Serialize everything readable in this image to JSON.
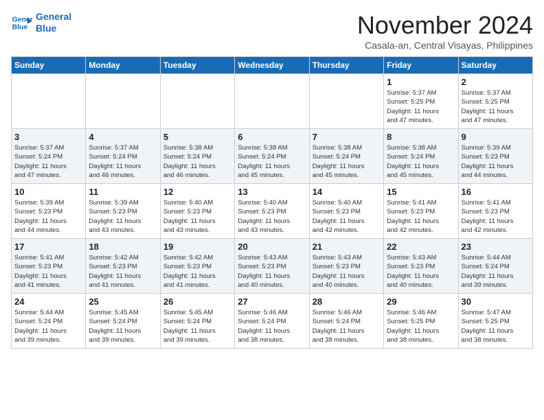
{
  "logo": {
    "line1": "General",
    "line2": "Blue"
  },
  "title": "November 2024",
  "location": "Casala-an, Central Visayas, Philippines",
  "columns": [
    "Sunday",
    "Monday",
    "Tuesday",
    "Wednesday",
    "Thursday",
    "Friday",
    "Saturday"
  ],
  "weeks": [
    [
      {
        "day": "",
        "info": ""
      },
      {
        "day": "",
        "info": ""
      },
      {
        "day": "",
        "info": ""
      },
      {
        "day": "",
        "info": ""
      },
      {
        "day": "",
        "info": ""
      },
      {
        "day": "1",
        "info": "Sunrise: 5:37 AM\nSunset: 5:25 PM\nDaylight: 11 hours\nand 47 minutes."
      },
      {
        "day": "2",
        "info": "Sunrise: 5:37 AM\nSunset: 5:25 PM\nDaylight: 11 hours\nand 47 minutes."
      }
    ],
    [
      {
        "day": "3",
        "info": "Sunrise: 5:37 AM\nSunset: 5:24 PM\nDaylight: 11 hours\nand 47 minutes."
      },
      {
        "day": "4",
        "info": "Sunrise: 5:37 AM\nSunset: 5:24 PM\nDaylight: 11 hours\nand 46 minutes."
      },
      {
        "day": "5",
        "info": "Sunrise: 5:38 AM\nSunset: 5:24 PM\nDaylight: 11 hours\nand 46 minutes."
      },
      {
        "day": "6",
        "info": "Sunrise: 5:38 AM\nSunset: 5:24 PM\nDaylight: 11 hours\nand 45 minutes."
      },
      {
        "day": "7",
        "info": "Sunrise: 5:38 AM\nSunset: 5:24 PM\nDaylight: 11 hours\nand 45 minutes."
      },
      {
        "day": "8",
        "info": "Sunrise: 5:38 AM\nSunset: 5:24 PM\nDaylight: 11 hours\nand 45 minutes."
      },
      {
        "day": "9",
        "info": "Sunrise: 5:39 AM\nSunset: 5:23 PM\nDaylight: 11 hours\nand 44 minutes."
      }
    ],
    [
      {
        "day": "10",
        "info": "Sunrise: 5:39 AM\nSunset: 5:23 PM\nDaylight: 11 hours\nand 44 minutes."
      },
      {
        "day": "11",
        "info": "Sunrise: 5:39 AM\nSunset: 5:23 PM\nDaylight: 11 hours\nand 43 minutes."
      },
      {
        "day": "12",
        "info": "Sunrise: 5:40 AM\nSunset: 5:23 PM\nDaylight: 11 hours\nand 43 minutes."
      },
      {
        "day": "13",
        "info": "Sunrise: 5:40 AM\nSunset: 5:23 PM\nDaylight: 11 hours\nand 43 minutes."
      },
      {
        "day": "14",
        "info": "Sunrise: 5:40 AM\nSunset: 5:23 PM\nDaylight: 11 hours\nand 42 minutes."
      },
      {
        "day": "15",
        "info": "Sunrise: 5:41 AM\nSunset: 5:23 PM\nDaylight: 11 hours\nand 42 minutes."
      },
      {
        "day": "16",
        "info": "Sunrise: 5:41 AM\nSunset: 5:23 PM\nDaylight: 11 hours\nand 42 minutes."
      }
    ],
    [
      {
        "day": "17",
        "info": "Sunrise: 5:41 AM\nSunset: 5:23 PM\nDaylight: 11 hours\nand 41 minutes."
      },
      {
        "day": "18",
        "info": "Sunrise: 5:42 AM\nSunset: 5:23 PM\nDaylight: 11 hours\nand 41 minutes."
      },
      {
        "day": "19",
        "info": "Sunrise: 5:42 AM\nSunset: 5:23 PM\nDaylight: 11 hours\nand 41 minutes."
      },
      {
        "day": "20",
        "info": "Sunrise: 5:43 AM\nSunset: 5:23 PM\nDaylight: 11 hours\nand 40 minutes."
      },
      {
        "day": "21",
        "info": "Sunrise: 5:43 AM\nSunset: 5:23 PM\nDaylight: 11 hours\nand 40 minutes."
      },
      {
        "day": "22",
        "info": "Sunrise: 5:43 AM\nSunset: 5:23 PM\nDaylight: 11 hours\nand 40 minutes."
      },
      {
        "day": "23",
        "info": "Sunrise: 5:44 AM\nSunset: 5:24 PM\nDaylight: 11 hours\nand 39 minutes."
      }
    ],
    [
      {
        "day": "24",
        "info": "Sunrise: 5:44 AM\nSunset: 5:24 PM\nDaylight: 11 hours\nand 39 minutes."
      },
      {
        "day": "25",
        "info": "Sunrise: 5:45 AM\nSunset: 5:24 PM\nDaylight: 11 hours\nand 39 minutes."
      },
      {
        "day": "26",
        "info": "Sunrise: 5:45 AM\nSunset: 5:24 PM\nDaylight: 11 hours\nand 39 minutes."
      },
      {
        "day": "27",
        "info": "Sunrise: 5:46 AM\nSunset: 5:24 PM\nDaylight: 11 hours\nand 38 minutes."
      },
      {
        "day": "28",
        "info": "Sunrise: 5:46 AM\nSunset: 5:24 PM\nDaylight: 11 hours\nand 38 minutes."
      },
      {
        "day": "29",
        "info": "Sunrise: 5:46 AM\nSunset: 5:25 PM\nDaylight: 11 hours\nand 38 minutes."
      },
      {
        "day": "30",
        "info": "Sunrise: 5:47 AM\nSunset: 5:25 PM\nDaylight: 11 hours\nand 38 minutes."
      }
    ]
  ]
}
